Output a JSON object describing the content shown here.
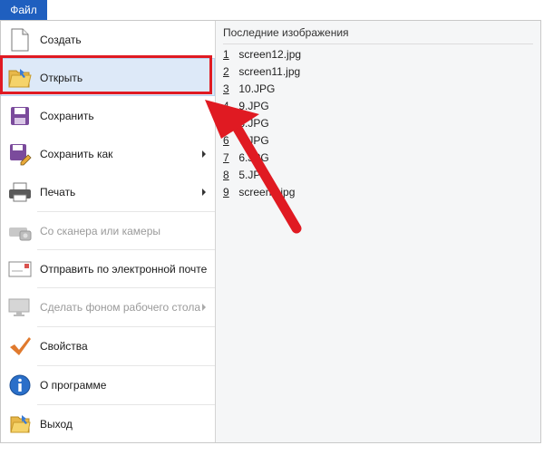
{
  "menubar": {
    "file_tab": "Файл"
  },
  "menu": {
    "items": [
      {
        "label": "Создать",
        "icon": "new-document-icon",
        "disabled": false,
        "submenu": false
      },
      {
        "label": "Открыть",
        "icon": "open-folder-icon",
        "disabled": false,
        "submenu": false
      },
      {
        "label": "Сохранить",
        "icon": "save-floppy-icon",
        "disabled": false,
        "submenu": false
      },
      {
        "label": "Сохранить как",
        "icon": "save-as-icon",
        "disabled": false,
        "submenu": true
      },
      {
        "label": "Печать",
        "icon": "printer-icon",
        "disabled": false,
        "submenu": true
      },
      {
        "label": "Со сканера или камеры",
        "icon": "scanner-icon",
        "disabled": true,
        "submenu": false
      },
      {
        "label": "Отправить по электронной почте",
        "icon": "email-icon",
        "disabled": false,
        "submenu": false
      },
      {
        "label": "Сделать фоном рабочего стола",
        "icon": "desktop-background-icon",
        "disabled": true,
        "submenu": true
      },
      {
        "label": "Свойства",
        "icon": "properties-checkmark-icon",
        "disabled": false,
        "submenu": false
      },
      {
        "label": "О программе",
        "icon": "info-icon",
        "disabled": false,
        "submenu": false
      },
      {
        "label": "Выход",
        "icon": "exit-icon",
        "disabled": false,
        "submenu": false
      }
    ]
  },
  "recent": {
    "title": "Последние изображения",
    "items": [
      {
        "num": "1",
        "name": "screen12.jpg"
      },
      {
        "num": "2",
        "name": "screen11.jpg"
      },
      {
        "num": "3",
        "name": "10.JPG"
      },
      {
        "num": "4",
        "name": "9.JPG"
      },
      {
        "num": "5",
        "name": "8.JPG"
      },
      {
        "num": "6",
        "name": "7.JPG"
      },
      {
        "num": "7",
        "name": "6.JPG"
      },
      {
        "num": "8",
        "name": "5.JPG"
      },
      {
        "num": "9",
        "name": "screen2.jpg"
      }
    ]
  },
  "colors": {
    "accent_tab": "#1f5fbf",
    "annotation_red": "#e01a22",
    "highlight": "#dde9f8"
  }
}
